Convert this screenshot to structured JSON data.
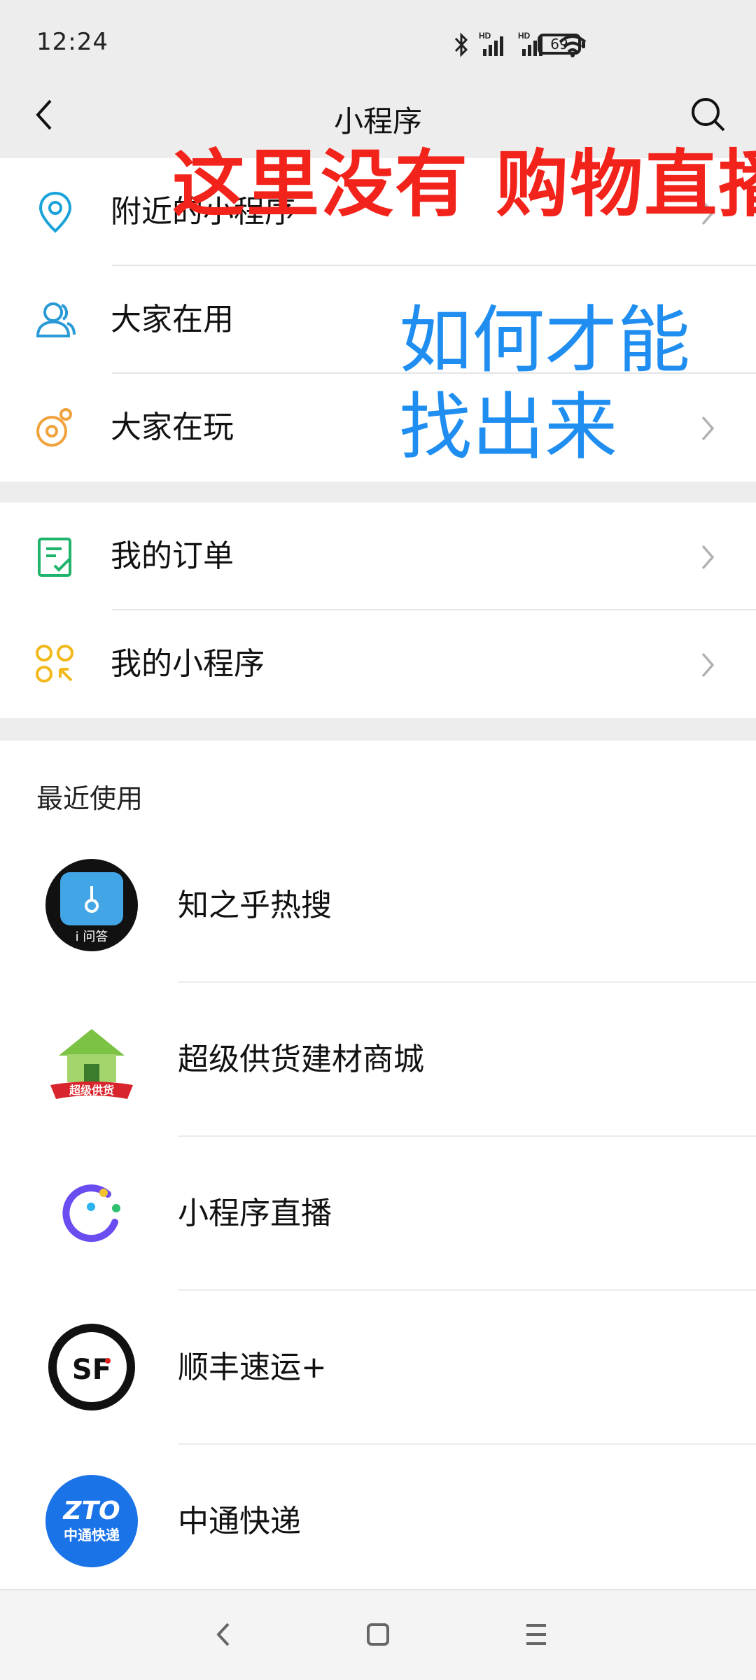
{
  "status_bar": {
    "time": "12:24",
    "battery": "69",
    "signal_1": "HD",
    "signal_2": "HD"
  },
  "nav": {
    "title": "小程序"
  },
  "group1": [
    {
      "label": "附近的小程序",
      "icon": "location-pin-icon"
    },
    {
      "label": "大家在用",
      "icon": "people-icon"
    },
    {
      "label": "大家在玩",
      "icon": "game-icon"
    }
  ],
  "group2": [
    {
      "label": "我的订单",
      "icon": "order-list-icon"
    },
    {
      "label": "我的小程序",
      "icon": "my-apps-icon"
    }
  ],
  "recent": {
    "header": "最近使用",
    "items": [
      {
        "name": "知之乎热搜",
        "logo_label": "i 问答"
      },
      {
        "name": "超级供货建材商城",
        "logo_label": "超级供货"
      },
      {
        "name": "小程序直播"
      },
      {
        "name": "顺丰速运+",
        "logo_label": "SF"
      },
      {
        "name": "中通快递",
        "logo_label_top": "ZTO",
        "logo_label_bottom": "中通快递"
      }
    ]
  },
  "annotations": {
    "red_note": "这里没有 购物直播",
    "blue_note": "如何才能找出来"
  },
  "colors": {
    "red_note": "#f2231b",
    "blue_note": "#1f8ef0",
    "location_icon": "#1aa3d9",
    "people_icon": "#2a9ad6",
    "game_icon": "#f0a23c",
    "order_icon": "#1fb36b",
    "my_apps_icon": "#f2b81c"
  }
}
